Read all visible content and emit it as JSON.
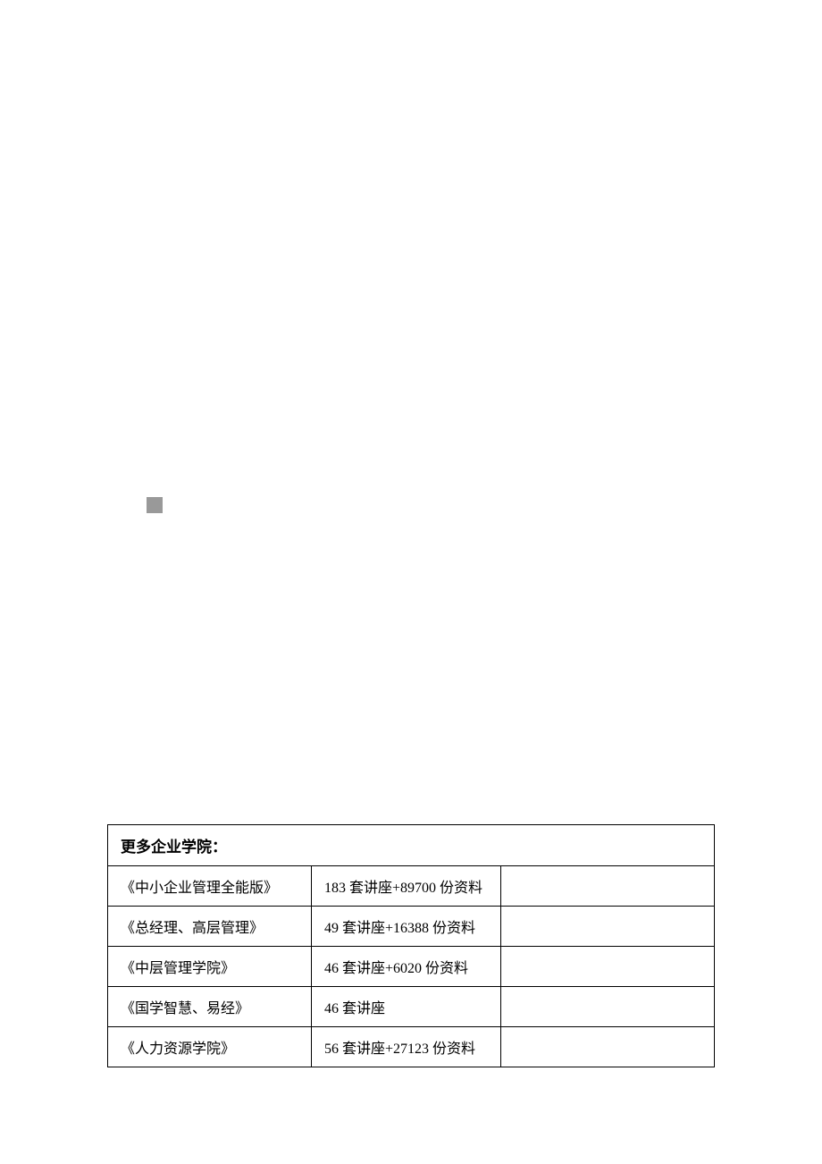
{
  "table": {
    "header": "更多企业学院：",
    "rows": [
      {
        "name": "《中小企业管理全能版》",
        "content": "183 套讲座+89700 份资料",
        "extra": ""
      },
      {
        "name": "《总经理、高层管理》",
        "content": "49 套讲座+16388 份资料",
        "extra": ""
      },
      {
        "name": "《中层管理学院》",
        "content": "46 套讲座+6020 份资料",
        "extra": ""
      },
      {
        "name": "《国学智慧、易经》",
        "content": "46 套讲座",
        "extra": ""
      },
      {
        "name": "《人力资源学院》",
        "content": "56 套讲座+27123 份资料",
        "extra": ""
      }
    ]
  }
}
